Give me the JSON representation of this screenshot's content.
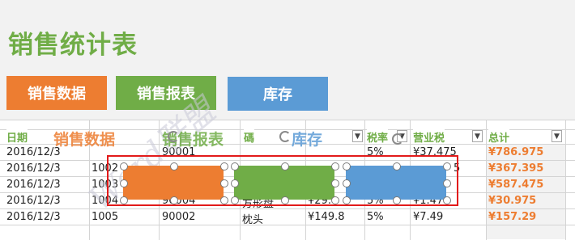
{
  "title": "销售统计表",
  "buttons": {
    "sales_data": "销售数据",
    "sales_report": "销售报表",
    "inventory": "库存"
  },
  "columns": {
    "date": "日期",
    "tax_rate": "税率",
    "business_tax": "营业税",
    "total": "总计"
  },
  "ghost_labels": {
    "sales_data": "销售数据",
    "sales_report": "销售报表",
    "inventory": "库存"
  },
  "rows": [
    {
      "date": "2016/12/3",
      "c2": "",
      "c3": "90001",
      "item": "",
      "price": "",
      "tax_rate": "5%",
      "tax": "¥37.475",
      "total": "¥786.975"
    },
    {
      "date": "2016/12/3",
      "c2": "1002",
      "c3": "",
      "item": "",
      "price": "",
      "tax_rate": "",
      "tax": "",
      "total": "¥367.395"
    },
    {
      "date": "2016/12/3",
      "c2": "1003",
      "c3": "",
      "item": "",
      "price": "",
      "tax_rate": "",
      "tax": "",
      "total": "¥587.475"
    },
    {
      "date": "2016/12/3",
      "c2": "1004",
      "c3": "90004",
      "item": "方形盘",
      "price": "¥29.",
      "tax_rate": "5%",
      "tax": "¥1.47",
      "total": "¥30.975"
    },
    {
      "date": "2016/12/3",
      "c2": "1005",
      "c3": "90002",
      "item": "枕头",
      "price": "¥149.8",
      "tax_rate": "5%",
      "tax": "¥7.49",
      "total": "¥157.29"
    }
  ],
  "partial_header": "碼",
  "partial_tax_suffix": "5",
  "watermark": "Word联盟",
  "colors": {
    "orange": "#ed7d31",
    "green": "#70ad47",
    "blue": "#5b9bd5",
    "selection": "#e21a1a"
  }
}
